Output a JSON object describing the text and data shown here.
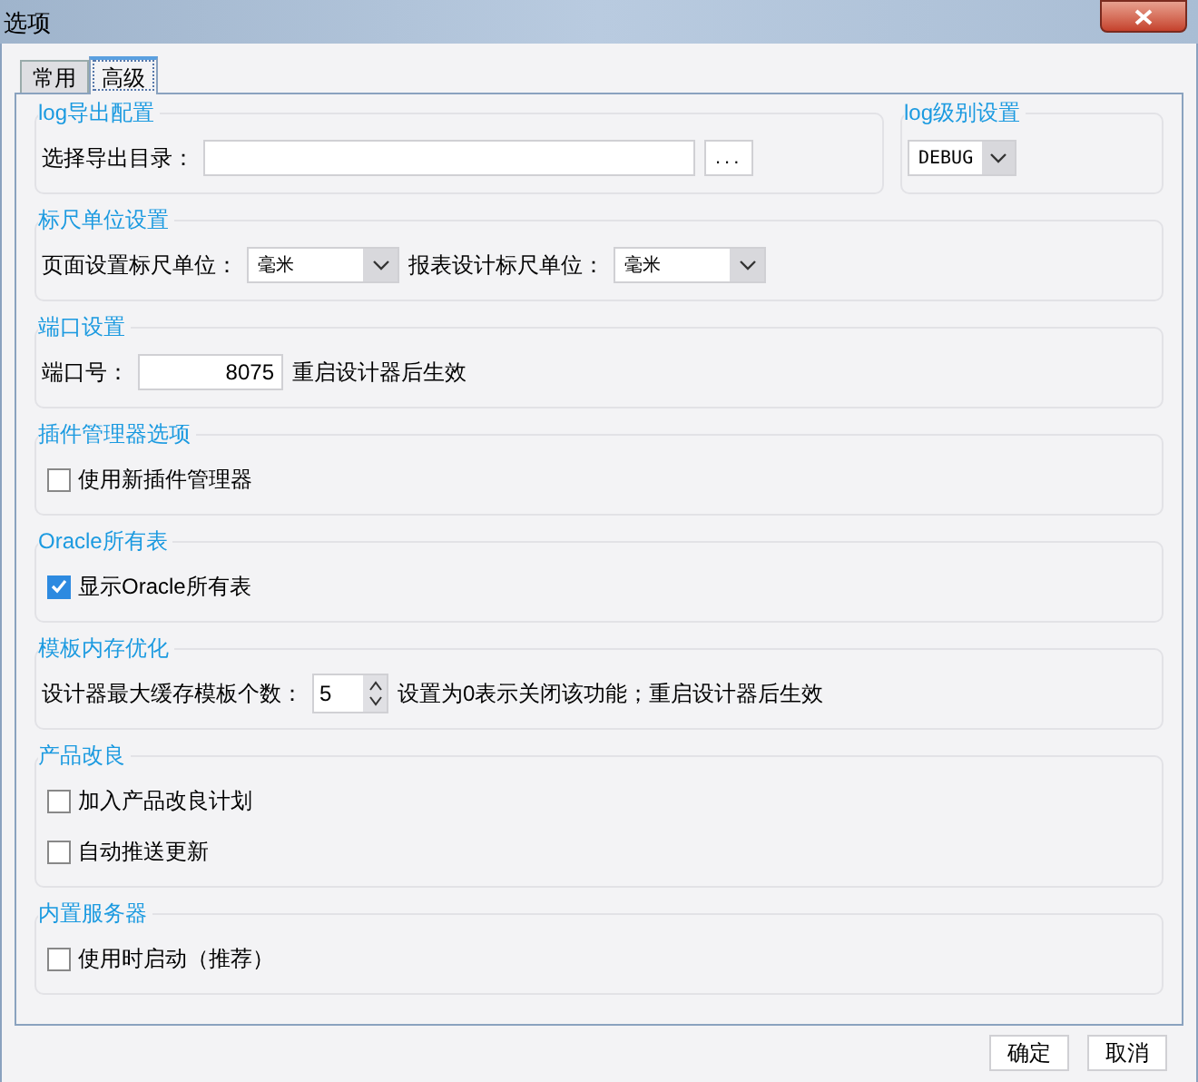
{
  "window": {
    "title": "选项"
  },
  "tabs": [
    {
      "label": "常用",
      "selected": false
    },
    {
      "label": "高级",
      "selected": true
    }
  ],
  "top_groups": [
    {
      "title": "log导出配置",
      "rows": [
        [
          {
            "kind": "label",
            "text": "选择导出目录："
          },
          {
            "kind": "field"
          },
          {
            "kind": "button",
            "label": "..."
          }
        ]
      ]
    },
    {
      "title": "log级别设置",
      "rows": [
        [
          {
            "kind": "select",
            "value": "DEBUG"
          }
        ]
      ]
    }
  ],
  "sections": [
    {
      "title": "标尺单位设置",
      "rows": [
        [
          {
            "kind": "label",
            "text": "页面设置标尺单位："
          },
          {
            "kind": "select",
            "value": "毫米"
          },
          {
            "kind": "label",
            "text": "报表设计标尺单位："
          },
          {
            "kind": "select",
            "value": "毫米"
          }
        ]
      ]
    },
    {
      "title": "端口设置",
      "rows": [
        [
          {
            "kind": "label",
            "text": "端口号："
          },
          {
            "kind": "field",
            "value": "8075"
          },
          {
            "kind": "label",
            "text": "重启设计器后生效"
          }
        ]
      ]
    },
    {
      "title": "插件管理器选项",
      "rows": [
        [
          {
            "kind": "checkbox",
            "label": "使用新插件管理器",
            "checked": false
          }
        ]
      ]
    },
    {
      "title": "Oracle所有表",
      "rows": [
        [
          {
            "kind": "checkbox",
            "label": "显示Oracle所有表",
            "checked": true
          }
        ]
      ]
    },
    {
      "title": "模板内存优化",
      "rows": [
        [
          {
            "kind": "label",
            "text": "设计器最大缓存模板个数："
          },
          {
            "kind": "spinner",
            "value": "5"
          },
          {
            "kind": "label",
            "text": "设置为0表示关闭该功能；重启设计器后生效"
          }
        ]
      ]
    },
    {
      "title": "产品改良",
      "rows": [
        [
          {
            "kind": "checkbox",
            "label": "加入产品改良计划",
            "checked": false
          }
        ],
        [
          {
            "kind": "checkbox",
            "label": "自动推送更新",
            "checked": false
          }
        ]
      ]
    },
    {
      "title": "内置服务器",
      "rows": [
        [
          {
            "kind": "checkbox",
            "label": "使用时启动（推荐）",
            "checked": false
          }
        ]
      ]
    }
  ],
  "buttons": [
    "确定",
    "取消"
  ]
}
